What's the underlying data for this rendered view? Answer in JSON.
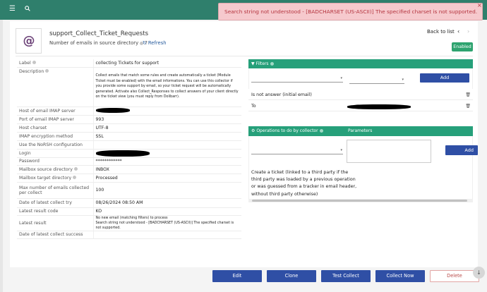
{
  "topbar": {
    "menu_icon": "☰",
    "search_icon": "🔍"
  },
  "alert": {
    "text": "Search string not understood - [BADCHARSET (US-ASCII)] The specified charset is not supported.",
    "close": "×"
  },
  "header": {
    "logo_glyph": "@",
    "title": "support_Collect_Ticket_Requests",
    "subtitle": "Number of emails in source directory",
    "subtitle_value": "?",
    "refresh_label": "Refresh",
    "back_label": "Back to list",
    "status": "Enabled"
  },
  "properties": [
    {
      "label": "Label",
      "value": "collecting Tickets for support"
    },
    {
      "label": "Description",
      "value": "Collect emails that match some rules and create automatically a ticket (Module Ticket must be enabled) with the email informations. You can use this collector if you provide some support by email, so your ticket request will be automatically generated. Activate also Collect_Responses to collect answers of your client directly on the ticket view (you must reply from Dolibarr)."
    },
    {
      "label": "Host of email IMAP server",
      "value": ""
    },
    {
      "label": "Port of email IMAP server",
      "value": "993"
    },
    {
      "label": "Host charset",
      "value": "UTF-8"
    },
    {
      "label": "IMAP encryption method",
      "value": "SSL"
    },
    {
      "label": "Use the NoRSH configuration",
      "value": ""
    },
    {
      "label": "Login",
      "value": ""
    },
    {
      "label": "Password",
      "value": "************"
    },
    {
      "label": "Mailbox source directory",
      "value": "INBOX"
    },
    {
      "label": "Mailbox target directory",
      "value": "Processed"
    },
    {
      "label": "Max number of emails collected per collect",
      "value": "100"
    },
    {
      "label": "Date of latest collect try",
      "value": "08/26/2024 08:50 AM"
    },
    {
      "label": "Latest result code",
      "value": "KO"
    },
    {
      "label": "Latest result",
      "value": "No new email (matching filters) to process\nSearch string not understood - [BADCHARSET (US-ASCII)] The specified charset is not supported."
    },
    {
      "label": "Date of latest collect success",
      "value": ""
    }
  ],
  "filters": {
    "title": "Filters",
    "add_label": "Add",
    "rows": [
      {
        "label": "Is not answer (initial email)"
      },
      {
        "label": "To"
      }
    ]
  },
  "operations": {
    "title": "Operations to do by collector",
    "params_header": "Parameters",
    "add_label": "Add",
    "description": "Create a ticket (linked to a third party if the third party was loaded by a previous operation or was guessed from a tracker in email header, without third party otherwise)"
  },
  "footer": {
    "edit": "Edit",
    "clone": "Clone",
    "test": "Test Collect",
    "collect": "Collect Now",
    "delete": "Delete"
  },
  "colors": {
    "accent": "#2f7f6c",
    "panel": "#26a07a",
    "button": "#2f4fa5",
    "error_bg": "#f6c9cd"
  }
}
